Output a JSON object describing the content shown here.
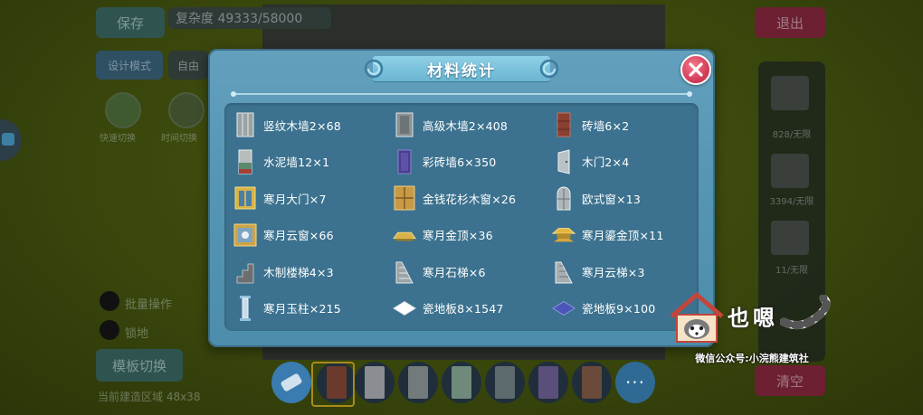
{
  "background": {
    "save_button": "保存",
    "score_text": "复杂度 49333/58000",
    "exit_button": "退出",
    "design_mode": "设计模式",
    "free_mode": "自由",
    "left_labels": [
      "快速切换",
      "时间切换"
    ],
    "batch_operation": "批量操作",
    "radio2": "锁地",
    "mode_switch": "模板切换",
    "build_area": "当前建造区域 48x38",
    "right_counts": [
      "828/无限",
      "3394/无限",
      "11/无限"
    ],
    "clear_button": "清空",
    "more_button": "···"
  },
  "dialog": {
    "title": "材料统计",
    "items": [
      {
        "label": "竖纹木墙2×68",
        "icon": "vertical-wood-wall-icon"
      },
      {
        "label": "高级木墙2×408",
        "icon": "advanced-wood-wall-icon"
      },
      {
        "label": "砖墙6×2",
        "icon": "brick-wall-icon"
      },
      {
        "label": "水泥墙12×1",
        "icon": "cement-wall-icon"
      },
      {
        "label": "彩砖墙6×350",
        "icon": "color-brick-wall-icon"
      },
      {
        "label": "木门2×4",
        "icon": "wood-door-icon"
      },
      {
        "label": "寒月大门×7",
        "icon": "hanyue-gate-icon"
      },
      {
        "label": "金钱花杉木窗×26",
        "icon": "fir-window-icon"
      },
      {
        "label": "欧式窗×13",
        "icon": "european-window-icon"
      },
      {
        "label": "寒月云窗×66",
        "icon": "hanyue-cloud-window-icon"
      },
      {
        "label": "寒月金顶×36",
        "icon": "hanyue-gold-roof-icon"
      },
      {
        "label": "寒月鎏金顶×11",
        "icon": "hanyue-gilded-roof-icon"
      },
      {
        "label": "木制楼梯4×3",
        "icon": "wood-stairs-icon"
      },
      {
        "label": "寒月石梯×6",
        "icon": "hanyue-stone-stairs-icon"
      },
      {
        "label": "寒月云梯×3",
        "icon": "hanyue-cloud-stairs-icon"
      },
      {
        "label": "寒月玉柱×215",
        "icon": "hanyue-jade-pillar-icon"
      },
      {
        "label": "瓷地板8×1547",
        "icon": "white-tile-floor-icon"
      },
      {
        "label": "瓷地板9×100",
        "icon": "blue-tile-floor-icon"
      }
    ]
  },
  "watermark": {
    "text": "也嗯",
    "subtitle": "微信公众号:小浣熊建筑社"
  },
  "colors": {
    "dialog_bg": "#5596b4",
    "content_bg": "#3c728f",
    "close_red": "#d43f5a"
  }
}
